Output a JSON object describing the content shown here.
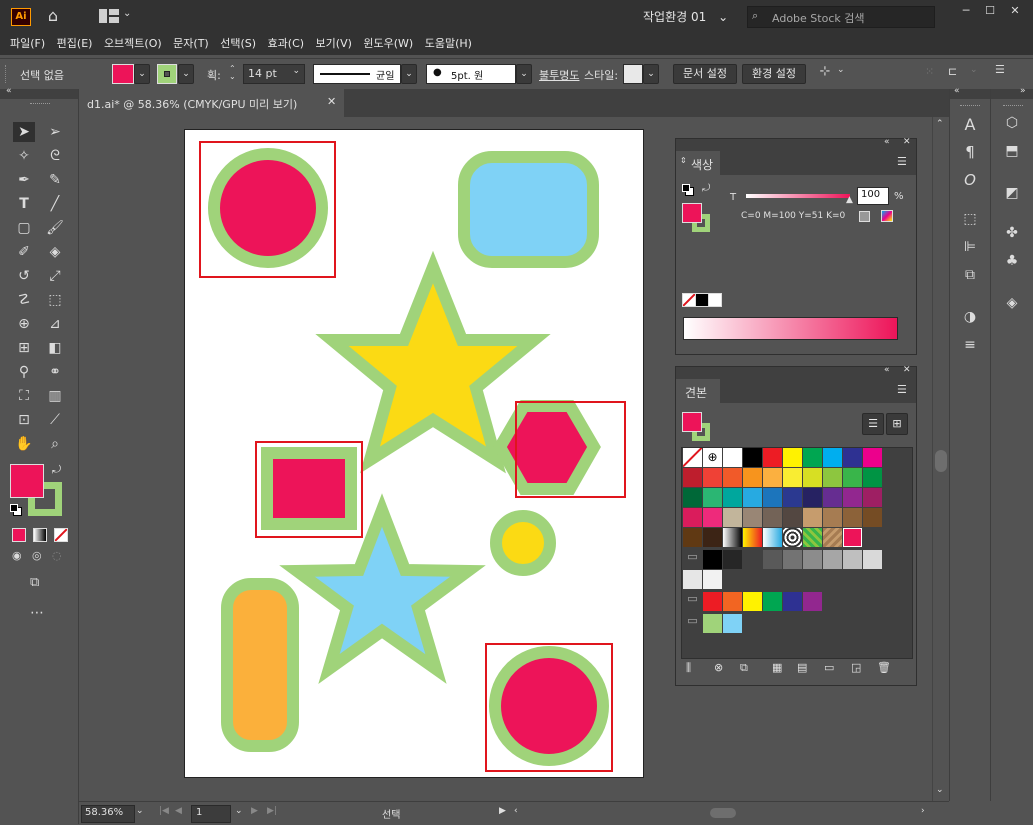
{
  "app": {
    "logo": "Ai",
    "workspace": "작업환경 01",
    "search_placeholder": "Adobe Stock 검색"
  },
  "menu": [
    "파일(F)",
    "편집(E)",
    "오브젝트(O)",
    "문자(T)",
    "선택(S)",
    "효과(C)",
    "보기(V)",
    "윈도우(W)",
    "도움말(H)"
  ],
  "control": {
    "selection": "선택 없음",
    "stroke_label": "획:",
    "stroke_weight": "14 pt",
    "stroke_profile": "균일",
    "brush": "5pt. 원",
    "opacity_label": "불투명도",
    "style_label": "스타일:",
    "doc_setup": "문서 설정",
    "preferences": "환경 설정",
    "fill_color": "#ed1459",
    "stroke_color": "#a0d37a"
  },
  "document": {
    "tab_title": "d1.ai* @ 58.36% (CMYK/GPU 미리 보기)"
  },
  "color_panel": {
    "title": "색상",
    "t_label": "T",
    "t_value": "100",
    "percent": "%",
    "cmyk": "C=0 M=100 Y=51 K=0"
  },
  "swatches_panel": {
    "title": "견본"
  },
  "status": {
    "zoom": "58.36%",
    "page": "1",
    "mode": "선택"
  },
  "colors": {
    "magenta": "#ed1459",
    "green": "#a0d37a",
    "blue": "#7fd2f6",
    "yellow": "#fbda14",
    "orange": "#fbb03b",
    "red_box": "#e0151d"
  }
}
